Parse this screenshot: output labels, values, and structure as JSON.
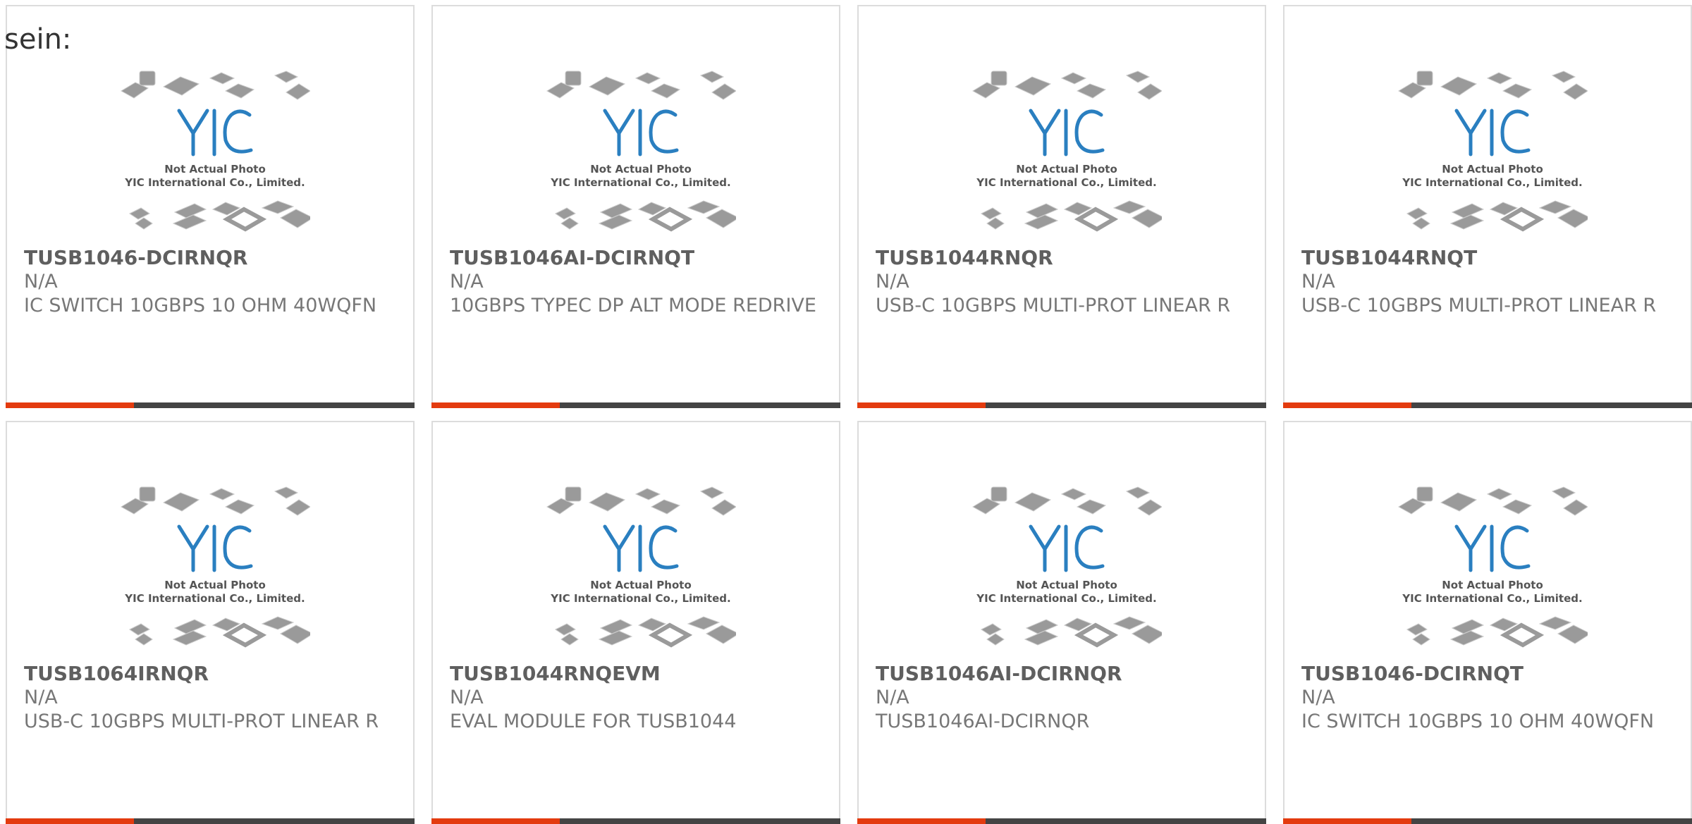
{
  "heading": "sein:",
  "image_caption": {
    "line1": "Not Actual Photo",
    "line2": "YIC International Co., Limited.",
    "logo": "YIC"
  },
  "colors": {
    "accent_bar": "#e33b0f",
    "bar": "#444444",
    "logo_blue": "#2a7fc0"
  },
  "products": [
    {
      "part": "TUSB1046-DCIRNQR",
      "mfr": "N/A",
      "desc": "IC SWITCH 10GBPS 10 OHM 40WQFN"
    },
    {
      "part": "TUSB1046AI-DCIRNQT",
      "mfr": "N/A",
      "desc": "10GBPS TYPEC DP ALT MODE REDRIVE"
    },
    {
      "part": "TUSB1044RNQR",
      "mfr": "N/A",
      "desc": "USB-C 10GBPS MULTI-PROT LINEAR R"
    },
    {
      "part": "TUSB1044RNQT",
      "mfr": "N/A",
      "desc": "USB-C 10GBPS MULTI-PROT LINEAR R"
    },
    {
      "part": "TUSB1064IRNQR",
      "mfr": "N/A",
      "desc": "USB-C 10GBPS MULTI-PROT LINEAR R"
    },
    {
      "part": "TUSB1044RNQEVM",
      "mfr": "N/A",
      "desc": "EVAL MODULE FOR TUSB1044"
    },
    {
      "part": "TUSB1046AI-DCIRNQR",
      "mfr": "N/A",
      "desc": "TUSB1046AI-DCIRNQR"
    },
    {
      "part": "TUSB1046-DCIRNQT",
      "mfr": "N/A",
      "desc": "IC SWITCH 10GBPS 10 OHM 40WQFN"
    }
  ]
}
